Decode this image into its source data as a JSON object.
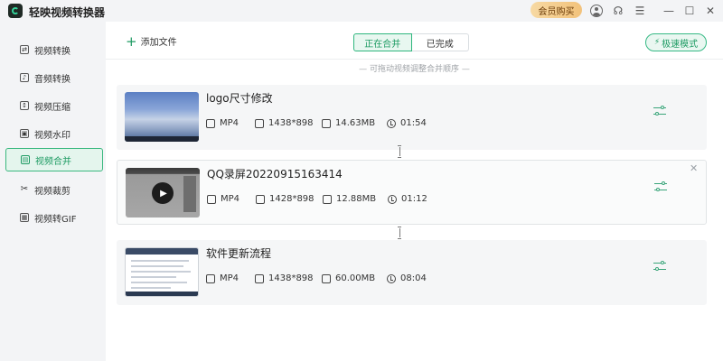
{
  "app": {
    "title": "轻映视频转换器",
    "vip_label": "会员购买"
  },
  "sidebar": {
    "items": [
      {
        "label": "视频转换",
        "icon": "video-convert-icon",
        "active": false
      },
      {
        "label": "音频转换",
        "icon": "audio-convert-icon",
        "active": false
      },
      {
        "label": "视频压缩",
        "icon": "compress-icon",
        "active": false
      },
      {
        "label": "视频水印",
        "icon": "watermark-icon",
        "active": false
      },
      {
        "label": "视频合并",
        "icon": "merge-icon",
        "active": true
      },
      {
        "label": "视频裁剪",
        "icon": "scissors-icon",
        "active": false
      },
      {
        "label": "视频转GIF",
        "icon": "gif-icon",
        "active": false
      }
    ]
  },
  "toolbar": {
    "add_file_label": "添加文件",
    "tabs": [
      {
        "label": "正在合并",
        "active": true
      },
      {
        "label": "已完成",
        "active": false
      }
    ],
    "fast_mode_label": "极速模式"
  },
  "hint": "— 可拖动视频调整合并顺序 —",
  "videos": [
    {
      "name": "logo尺寸修改",
      "format": "MP4",
      "resolution": "1438*898",
      "size": "14.63MB",
      "duration": "01:54"
    },
    {
      "name": "QQ录屏20220915163414",
      "format": "MP4",
      "resolution": "1428*898",
      "size": "12.88MB",
      "duration": "01:12"
    },
    {
      "name": "软件更新流程",
      "format": "MP4",
      "resolution": "1438*898",
      "size": "60.00MB",
      "duration": "08:04"
    }
  ],
  "colors": {
    "accent": "#1e9b63",
    "vip": "#f2c27b"
  }
}
